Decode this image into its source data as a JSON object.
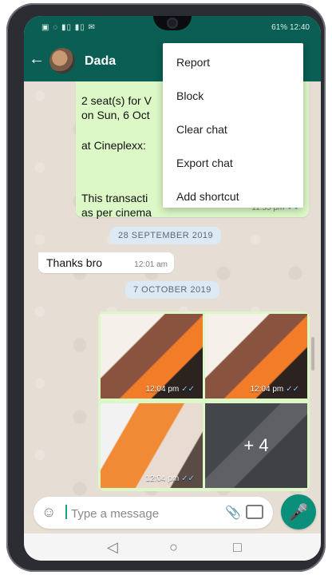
{
  "status_bar": {
    "left_icons": "▣ ◌ ▮▯ ▮▯ ✉",
    "right_text": "61% 12:40"
  },
  "header": {
    "contact_name": "Dada"
  },
  "messages": {
    "outgoing_lines": [
      "2 seat(s) for V",
      "on Sun, 6 Oct",
      "at Cineplexx:",
      "This transacti",
      "as per cinema"
    ],
    "outgoing_time": "11:55 pm",
    "date_chip_1": "28 SEPTEMBER 2019",
    "incoming_text": "Thanks bro",
    "incoming_time": "12:01 am",
    "date_chip_2": "7 OCTOBER 2019",
    "media_times": [
      "12:04 pm",
      "12:04 pm",
      "12:04 pm"
    ],
    "more_media_count": "+ 4"
  },
  "composer": {
    "placeholder": "Type a message"
  },
  "menu": {
    "items": [
      "Report",
      "Block",
      "Clear chat",
      "Export chat",
      "Add shortcut"
    ]
  },
  "icons": {
    "back": "arrow-left",
    "emoji": "smiley",
    "attach": "paperclip",
    "camera": "camera",
    "mic": "microphone",
    "nav_back": "triangle-left",
    "nav_home": "circle",
    "nav_recent": "square"
  }
}
